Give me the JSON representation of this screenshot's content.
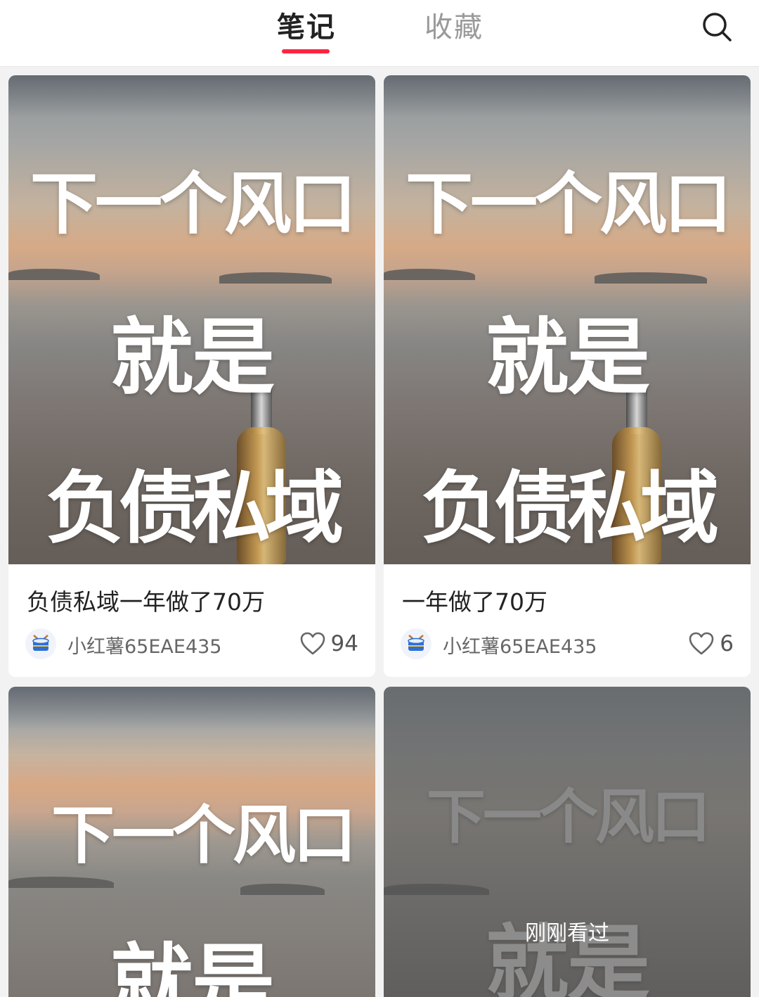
{
  "theme": {
    "accent": "#ff2442"
  },
  "header": {
    "tabs": [
      {
        "label": "笔记",
        "active": true
      },
      {
        "label": "收藏",
        "active": false
      }
    ],
    "search_icon": "search-icon"
  },
  "notes": [
    {
      "cover_lines": [
        "下一个风口",
        "就是",
        "负债私域"
      ],
      "title": "负债私域一年做了70万",
      "author": "小红薯65EAE435",
      "likes": "94",
      "avatar_icon": "drum-icon"
    },
    {
      "cover_lines": [
        "下一个风口",
        "就是",
        "负债私域"
      ],
      "title": "一年做了70万",
      "author": "小红薯65EAE435",
      "likes": "6",
      "avatar_icon": "drum-icon"
    },
    {
      "cover_lines": [
        "下一个风口",
        "就是"
      ],
      "viewed": false
    },
    {
      "cover_lines": [
        "下一个风口",
        "就是"
      ],
      "viewed": true,
      "viewed_label": "刚刚看过"
    }
  ]
}
